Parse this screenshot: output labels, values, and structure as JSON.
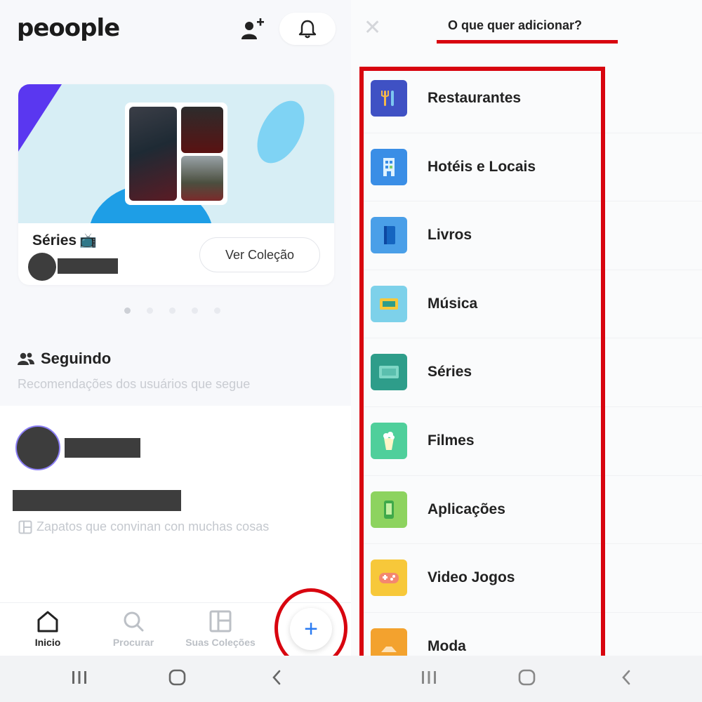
{
  "header": {
    "logo": "peoople"
  },
  "collection_card": {
    "title": "Séries",
    "title_emoji": "📺",
    "button_label": "Ver Coleção",
    "pager_count": 5,
    "pager_active": 0
  },
  "following": {
    "title": "Seguindo",
    "subtitle": "Recomendações dos usuários que segue",
    "post_collection": "Zapatos que convinan con muchas cosas"
  },
  "tabbar": {
    "tabs": [
      {
        "label": "Inicio",
        "icon": "home-icon",
        "active": true
      },
      {
        "label": "Procurar",
        "icon": "search-icon",
        "active": false
      },
      {
        "label": "Suas Coleções",
        "icon": "collections-icon",
        "active": false
      }
    ],
    "fab_label": "+"
  },
  "add_panel": {
    "title": "O que quer adicionar?",
    "items": [
      {
        "label": "Restaurantes",
        "icon": "restaurant-icon",
        "color": "#3f51c4"
      },
      {
        "label": "Hotéis e Locais",
        "icon": "hotel-icon",
        "color": "#3a8ee6"
      },
      {
        "label": "Livros",
        "icon": "book-icon",
        "color": "#4a9fe8"
      },
      {
        "label": "Música",
        "icon": "music-icon",
        "color": "#7dd1ea"
      },
      {
        "label": "Séries",
        "icon": "tv-icon",
        "color": "#2e9d8a"
      },
      {
        "label": "Filmes",
        "icon": "film-icon",
        "color": "#4fcf9b"
      },
      {
        "label": "Aplicações",
        "icon": "app-icon",
        "color": "#8dd35f"
      },
      {
        "label": "Video Jogos",
        "icon": "gamepad-icon",
        "color": "#f7c83a"
      },
      {
        "label": "Moda",
        "icon": "fashion-icon",
        "color": "#f3a22e"
      }
    ]
  },
  "colors": {
    "highlight": "#d8050f",
    "fab_plus": "#2a7bf2",
    "accent_purple": "#5a37f0"
  }
}
